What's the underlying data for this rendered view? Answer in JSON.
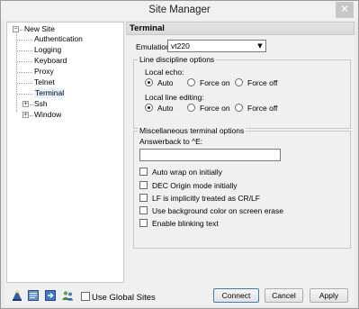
{
  "window": {
    "title": "Site Manager",
    "close_glyph": "✕"
  },
  "tree": {
    "root": "New Site",
    "children": [
      "Authentication",
      "Logging",
      "Keyboard",
      "Proxy",
      "Telnet",
      "Terminal",
      "Ssh",
      "Window"
    ],
    "selected": "Terminal",
    "expandable": [
      "Ssh",
      "Window"
    ],
    "expand_glyph": "+",
    "collapse_glyph": "−"
  },
  "panel": {
    "title": "Terminal",
    "emulation": {
      "label": "Emulation:",
      "value": "vt220"
    },
    "line_discipline": {
      "title": "Line discipline options",
      "local_echo": {
        "label": "Local echo:",
        "options": [
          "Auto",
          "Force on",
          "Force off"
        ],
        "selected": "Auto"
      },
      "local_line_editing": {
        "label": "Local line editing:",
        "options": [
          "Auto",
          "Force on",
          "Force off"
        ],
        "selected": "Auto"
      }
    },
    "misc": {
      "title": "Miscellaneous terminal options",
      "answerback_label": "Answerback to ^E:",
      "answerback_value": "",
      "checkboxes": [
        {
          "label": "Auto wrap on initially",
          "checked": false
        },
        {
          "label": "DEC Origin mode initially",
          "checked": false
        },
        {
          "label": "LF is implicitly treated as CR/LF",
          "checked": false
        },
        {
          "label": "Use background color on screen erase",
          "checked": false
        },
        {
          "label": "Enable blinking text",
          "checked": false
        }
      ]
    }
  },
  "footer": {
    "icons": [
      "wizard-icon",
      "notes-icon",
      "import-icon",
      "people-icon"
    ],
    "use_global_sites": {
      "label": "Use Global Sites",
      "checked": false
    },
    "buttons": {
      "connect": "Connect",
      "cancel": "Cancel",
      "apply": "Apply"
    }
  },
  "colors": {
    "selected_bg": "#e5f3ff",
    "default_button_border": "#3c7fb1"
  }
}
